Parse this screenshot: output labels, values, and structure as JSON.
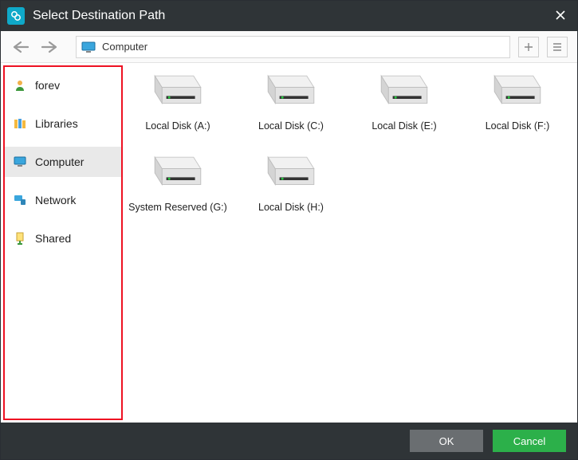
{
  "window": {
    "title": "Select Destination Path"
  },
  "toolbar": {
    "path": "Computer"
  },
  "sidebar": {
    "items": [
      {
        "label": "forev",
        "icon": "user-icon",
        "selected": false
      },
      {
        "label": "Libraries",
        "icon": "libraries-icon",
        "selected": false
      },
      {
        "label": "Computer",
        "icon": "monitor-icon",
        "selected": true
      },
      {
        "label": "Network",
        "icon": "network-icon",
        "selected": false
      },
      {
        "label": "Shared",
        "icon": "shared-icon",
        "selected": false
      }
    ]
  },
  "disks": [
    {
      "label": "Local Disk (A:)"
    },
    {
      "label": "Local Disk (C:)"
    },
    {
      "label": "Local Disk (E:)"
    },
    {
      "label": "Local Disk (F:)"
    },
    {
      "label": "System Reserved (G:)"
    },
    {
      "label": "Local Disk (H:)"
    }
  ],
  "footer": {
    "ok": "OK",
    "cancel": "Cancel"
  }
}
